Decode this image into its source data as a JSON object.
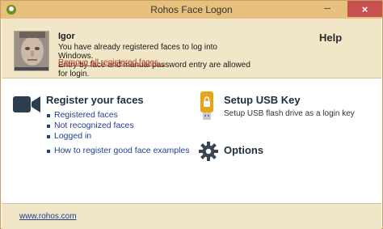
{
  "window": {
    "title": "Rohos Face Logon",
    "close_glyph": "×",
    "minimize_glyph": "─",
    "maximize_glyph": "□"
  },
  "header": {
    "user_name": "Igor",
    "message_lines": [
      "You have already registered faces to log into Windows.",
      "Entry by face and manual password entry are allowed for login."
    ],
    "remove_link": "Remove all registered faces...",
    "help_label": "Help"
  },
  "register": {
    "title": "Register your faces",
    "icon": "video-camera-icon",
    "items": [
      "Registered faces",
      "Not recognized faces",
      "Logged in",
      "How to register good face examples"
    ]
  },
  "usb": {
    "title": "Setup USB Key",
    "icon": "usb-key-icon",
    "description": "Setup USB flash drive as a login key"
  },
  "options": {
    "title": "Options",
    "icon": "gear-icon"
  },
  "footer": {
    "site_link": "www.rohos.com"
  },
  "colors": {
    "titlebar": "#e8c07e",
    "header_bg": "#f1e6c8",
    "link_blue": "#1f3f8f",
    "link_red": "#c0392b",
    "close_red": "#c75050"
  }
}
